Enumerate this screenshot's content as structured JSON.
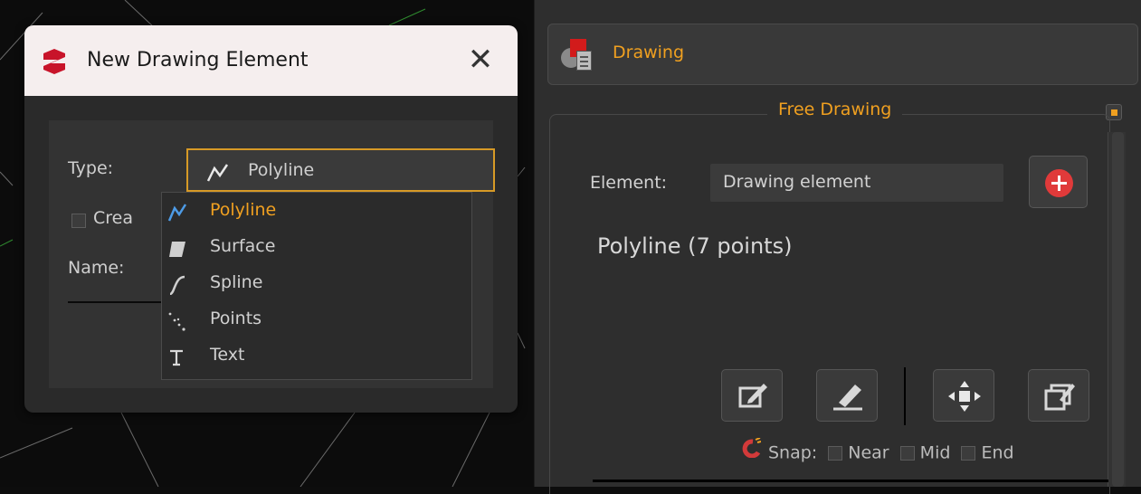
{
  "dialog": {
    "title": "New Drawing Element",
    "close_label": "✕",
    "type_label": "Type:",
    "type_value": "Polyline",
    "create_label": "Crea",
    "name_label": "Name:",
    "dropdown_options": [
      {
        "label": "Polyline",
        "icon": "polyline-icon",
        "selected": true
      },
      {
        "label": "Surface",
        "icon": "surface-icon",
        "selected": false
      },
      {
        "label": "Spline",
        "icon": "spline-icon",
        "selected": false
      },
      {
        "label": "Points",
        "icon": "points-icon",
        "selected": false
      },
      {
        "label": "Text",
        "icon": "text-icon",
        "selected": false
      }
    ]
  },
  "panel": {
    "title": "Drawing",
    "section_title": "Free Drawing",
    "element_label": "Element:",
    "element_value": "Drawing element",
    "summary": "Polyline (7 points)",
    "tools": [
      "edit-icon",
      "eraser-icon",
      "move-icon",
      "duplicate-icon"
    ],
    "snap_label": "Snap:",
    "snap_options": [
      "Near",
      "Mid",
      "End"
    ]
  },
  "colors": {
    "accent": "#f0a020",
    "titlebar": "#f5eeee",
    "panel_bg": "#2e2e2e",
    "add_button": "#e03a3a"
  }
}
